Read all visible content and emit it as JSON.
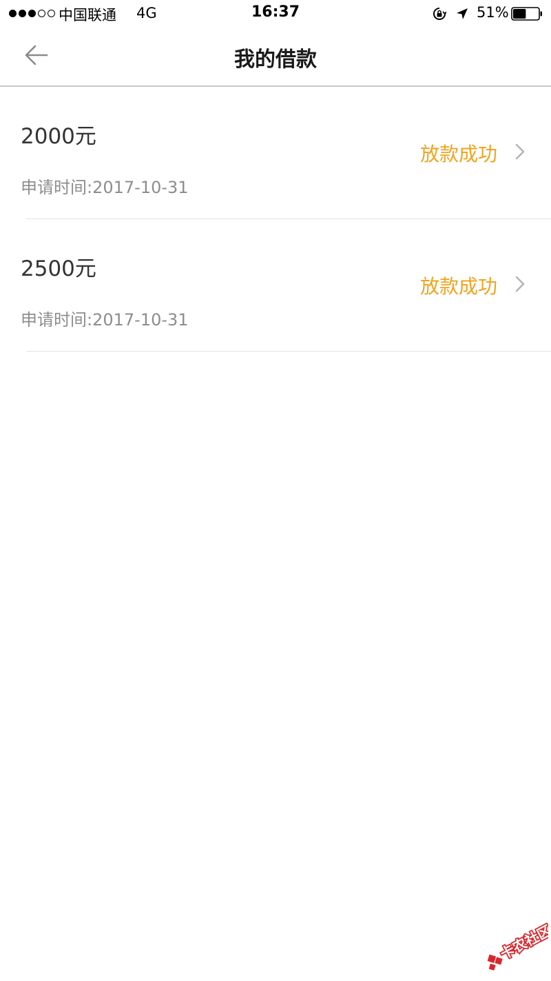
{
  "status_bar": {
    "carrier": "中国联通",
    "network": "4G",
    "time": "16:37",
    "battery_percent": "51%",
    "battery_level": 0.51,
    "signal_strength": 3,
    "signal_max": 5,
    "icons": [
      "signal-dots-icon",
      "orientation-lock-icon",
      "location-arrow-icon",
      "battery-icon"
    ]
  },
  "nav": {
    "title": "我的借款",
    "back_icon": "back-arrow-icon"
  },
  "loans": [
    {
      "amount": "2000元",
      "time_label": "申请时间:",
      "time_value": "2017-10-31",
      "status": "放款成功"
    },
    {
      "amount": "2500元",
      "time_label": "申请时间:",
      "time_value": "2017-10-31",
      "status": "放款成功"
    }
  ],
  "watermark": {
    "text": "卡农社区",
    "icon": "kanong-logo-icon"
  },
  "colors": {
    "status_success": "#f0a320",
    "amount_text": "#333333",
    "secondary_text": "#8d8d8d",
    "divider": "#e3e3e3",
    "watermark_red": "#d9262c"
  }
}
